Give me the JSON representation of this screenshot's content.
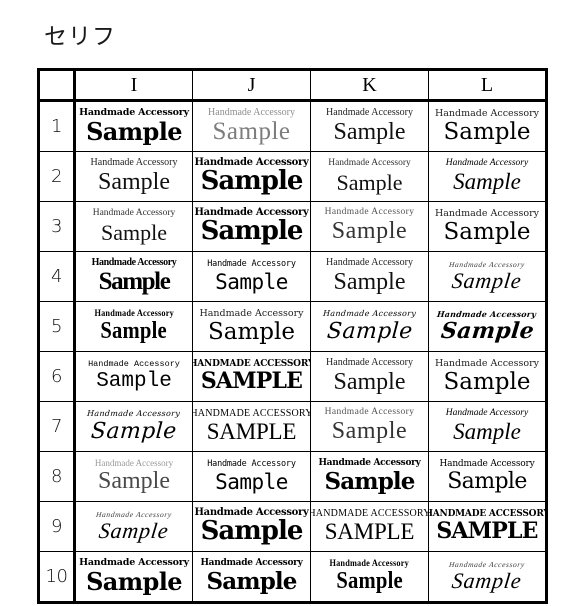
{
  "page": {
    "title": "セリフ",
    "background_color": "#ffffff",
    "text_color": "#000000"
  },
  "table": {
    "corner_label": "",
    "column_headers": [
      "I",
      "J",
      "K",
      "L"
    ],
    "row_labels": [
      "1",
      "2",
      "3",
      "4",
      "5",
      "6",
      "7",
      "8",
      "9",
      "10"
    ],
    "rows": [
      {
        "label": "1",
        "cells": [
          {
            "tagline": "Handmade Accessory",
            "sample": "Sample",
            "style": "f-bold-slab"
          },
          {
            "tagline": "Handmade Accessory",
            "sample": "Sample",
            "style": "f-light-serif"
          },
          {
            "tagline": "Handmade Accessory",
            "sample": "Sample",
            "style": "f-serif"
          },
          {
            "tagline": "Handmade Accessory",
            "sample": "Sample",
            "style": "f-serif-wide"
          }
        ]
      },
      {
        "label": "2",
        "cells": [
          {
            "tagline": "Handmade Accessory",
            "sample": "Sample",
            "style": "f-serif"
          },
          {
            "tagline": "Handmade Accessory",
            "sample": "Sample",
            "style": "f-bold-heavy"
          },
          {
            "tagline": "Handmade Accessory",
            "sample": "Sample",
            "style": "f-serif-sm"
          },
          {
            "tagline": "Handmade Accessory",
            "sample": "Sample",
            "style": "f-italic-serif"
          }
        ]
      },
      {
        "label": "3",
        "cells": [
          {
            "tagline": "Handmade Accessory",
            "sample": "Sample",
            "style": "f-serif-sm"
          },
          {
            "tagline": "Handmade Accessory",
            "sample": "Sample",
            "style": "f-bold-heavy"
          },
          {
            "tagline": "Handmade Accessory",
            "sample": "Sample",
            "style": "f-thin-deco"
          },
          {
            "tagline": "Handmade Accessory",
            "sample": "Sample",
            "style": "f-serif-wide"
          }
        ]
      },
      {
        "label": "4",
        "cells": [
          {
            "tagline": "Handmade Accessory",
            "sample": "Sample",
            "style": "f-bold-narrow"
          },
          {
            "tagline": "Handmade Accessory",
            "sample": "Sample",
            "style": "f-mono"
          },
          {
            "tagline": "Handmade Accessory",
            "sample": "Sample",
            "style": "f-serif"
          },
          {
            "tagline": "Handmade Accessory",
            "sample": "Sample",
            "style": "f-script-fine"
          }
        ]
      },
      {
        "label": "5",
        "cells": [
          {
            "tagline": "Handmade Accessory",
            "sample": "Sample",
            "style": "f-gothic"
          },
          {
            "tagline": "Handmade Accessory",
            "sample": "Sample",
            "style": "f-serif-wide"
          },
          {
            "tagline": "Handmade Accessory",
            "sample": "Sample",
            "style": "f-script"
          },
          {
            "tagline": "Handmade Accessory",
            "sample": "Sample",
            "style": "f-script-bold"
          }
        ]
      },
      {
        "label": "6",
        "cells": [
          {
            "tagline": "Handmade Accessory",
            "sample": "Sample",
            "style": "f-mono-serif"
          },
          {
            "tagline": "HANDMADE ACCESSORY",
            "sample": "SAMPLE",
            "style": "f-caps-bold"
          },
          {
            "tagline": "Handmade Accessory",
            "sample": "Sample",
            "style": "f-serif"
          },
          {
            "tagline": "Handmade Accessory",
            "sample": "Sample",
            "style": "f-serif-wide"
          }
        ]
      },
      {
        "label": "7",
        "cells": [
          {
            "tagline": "Handmade Accessory",
            "sample": "Sample",
            "style": "f-script"
          },
          {
            "tagline": "HANDMADE ACCESSORY",
            "sample": "SAMPLE",
            "style": "f-caps"
          },
          {
            "tagline": "Handmade Accessory",
            "sample": "Sample",
            "style": "f-thin-deco"
          },
          {
            "tagline": "Handmade Accessory",
            "sample": "Sample",
            "style": "f-italic-serif"
          }
        ]
      },
      {
        "label": "8",
        "cells": [
          {
            "tagline": "Handmade Accessory",
            "sample": "Sample",
            "style": "f-light-thin"
          },
          {
            "tagline": "Handmade Accessory",
            "sample": "Sample",
            "style": "f-mono"
          },
          {
            "tagline": "Handmade Accessory",
            "sample": "Sample",
            "style": "f-bold-compact"
          },
          {
            "tagline": "Handmade Accessory",
            "sample": "Sample",
            "style": "f-serif-tight"
          }
        ]
      },
      {
        "label": "9",
        "cells": [
          {
            "tagline": "Handmade Accessory",
            "sample": "Sample",
            "style": "f-script-fine"
          },
          {
            "tagline": "Handmade Accessory",
            "sample": "Sample",
            "style": "f-bold-heavy"
          },
          {
            "tagline": "HANDMADE ACCESSORY",
            "sample": "SAMPLE",
            "style": "f-caps"
          },
          {
            "tagline": "HANDMADE ACCESSORY",
            "sample": "SAMPLE",
            "style": "f-caps-bold"
          }
        ]
      },
      {
        "label": "10",
        "cells": [
          {
            "tagline": "Handmade Accessory",
            "sample": "Sample",
            "style": "f-bold-slab"
          },
          {
            "tagline": "Handmade Accessory",
            "sample": "Sample",
            "style": "f-bold-compact"
          },
          {
            "tagline": "Handmade Accessory",
            "sample": "Sample",
            "style": "f-gothic"
          },
          {
            "tagline": "Handmade Accessory",
            "sample": "Sample",
            "style": "f-script-fine"
          }
        ]
      }
    ]
  }
}
